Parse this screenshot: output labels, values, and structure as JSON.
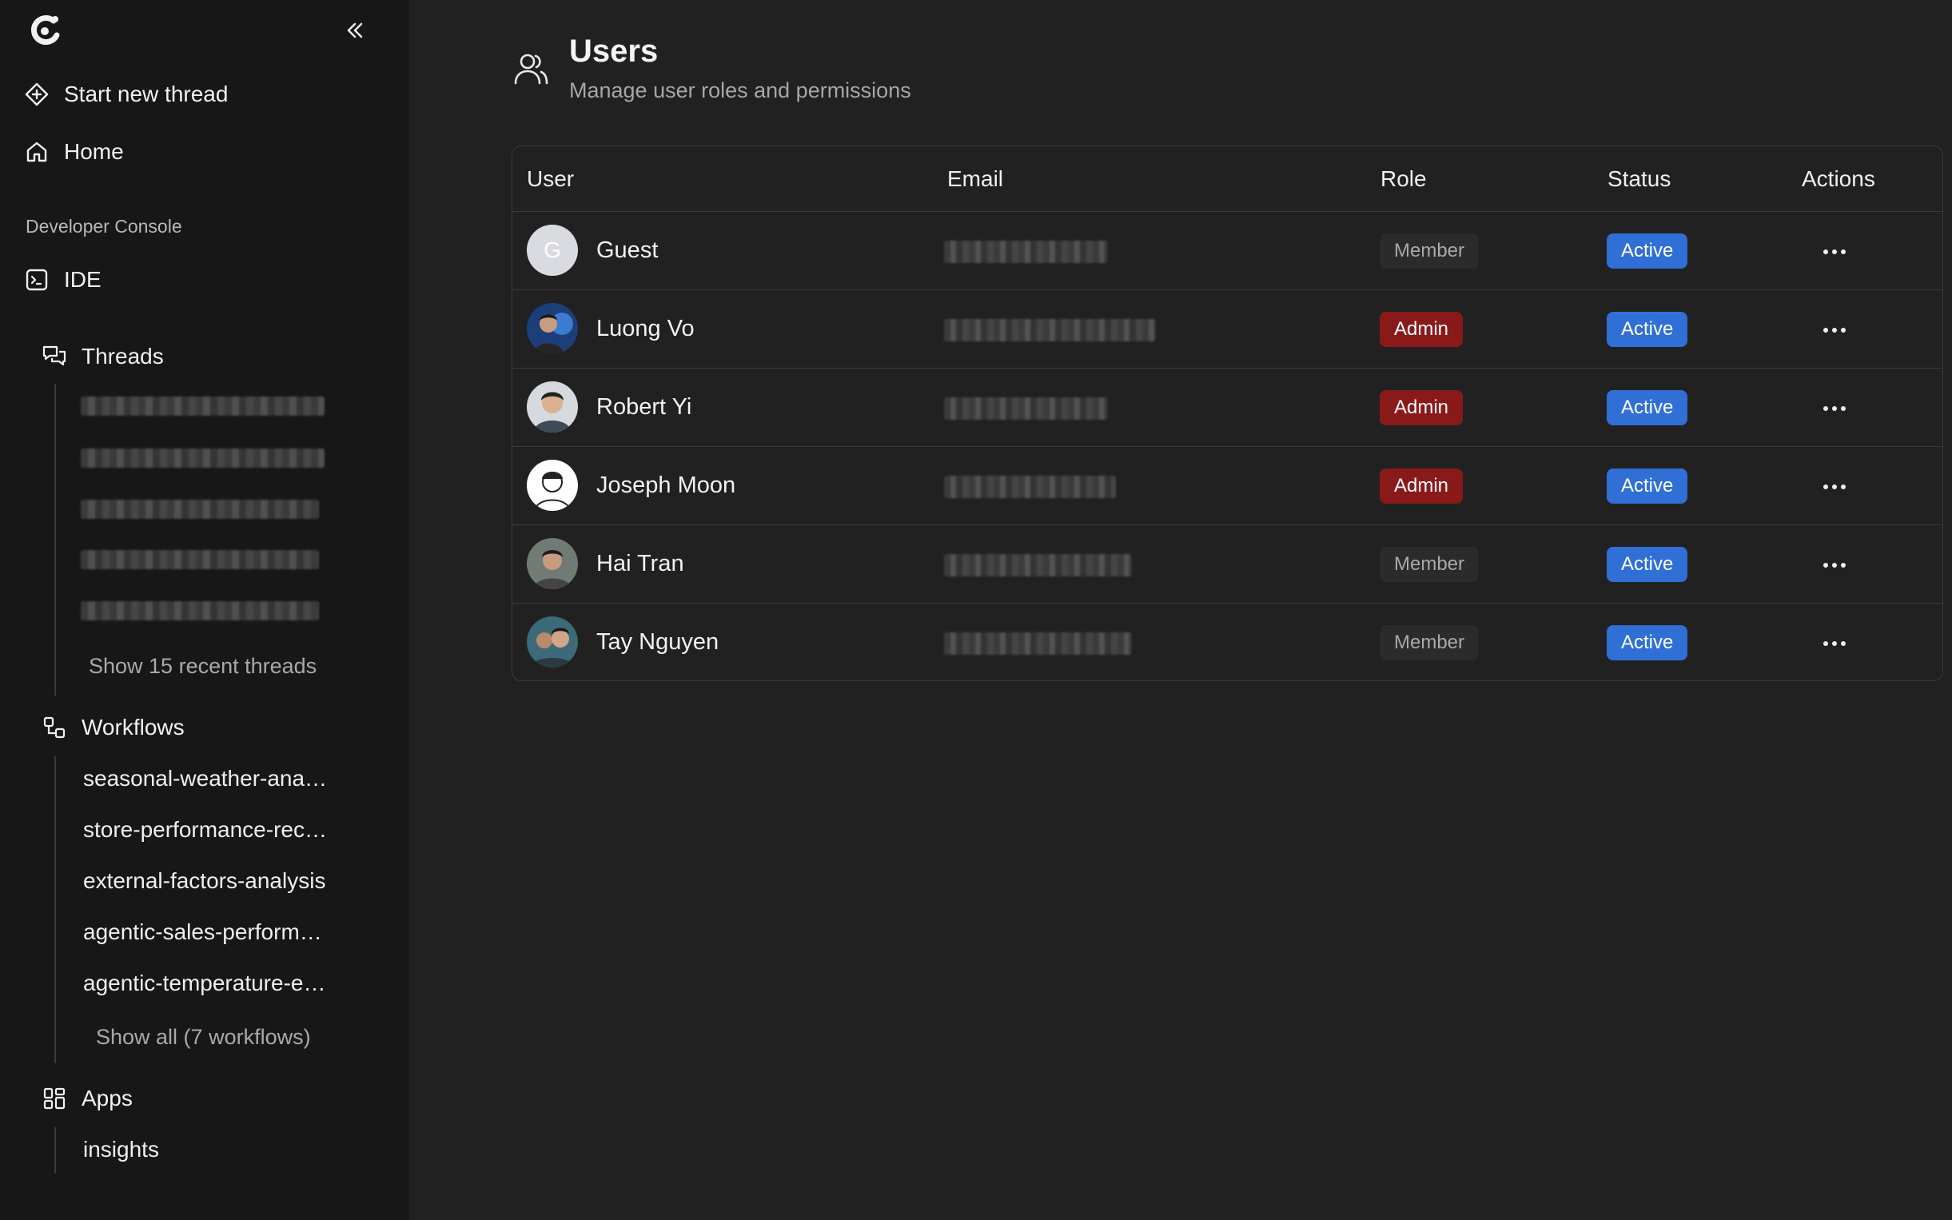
{
  "sidebar": {
    "logo": "app-logo",
    "collapse_icon": "double-chevron-left-icon",
    "start_thread": "Start new thread",
    "home": "Home",
    "section_label": "Developer Console",
    "ide": "IDE",
    "threads": {
      "label": "Threads",
      "show_more": "Show 15 recent threads"
    },
    "workflows": {
      "label": "Workflows",
      "items": [
        "seasonal-weather-ana…",
        "store-performance-rec…",
        "external-factors-analysis",
        "agentic-sales-perform…",
        "agentic-temperature-e…"
      ],
      "show_all": "Show all (7 workflows)"
    },
    "apps": {
      "label": "Apps",
      "items": [
        "insights"
      ]
    }
  },
  "main": {
    "title": "Users",
    "subtitle": "Manage user roles and permissions",
    "table": {
      "columns": [
        "User",
        "Email",
        "Role",
        "Status",
        "Actions"
      ],
      "rows": [
        {
          "initial": "G",
          "name": "Guest",
          "role": "Member",
          "status": "Active"
        },
        {
          "name": "Luong Vo",
          "role": "Admin",
          "status": "Active"
        },
        {
          "name": "Robert Yi",
          "role": "Admin",
          "status": "Active"
        },
        {
          "name": "Joseph Moon",
          "role": "Admin",
          "status": "Active"
        },
        {
          "name": "Hai Tran",
          "role": "Member",
          "status": "Active"
        },
        {
          "name": "Tay Nguyen",
          "role": "Member",
          "status": "Active"
        }
      ]
    }
  },
  "colors": {
    "sidebar_bg": "#171717",
    "main_bg": "#212121",
    "admin_badge": "#8a1a1a",
    "active_badge": "#2f6fd6",
    "member_badge": "#2b2b2b"
  }
}
